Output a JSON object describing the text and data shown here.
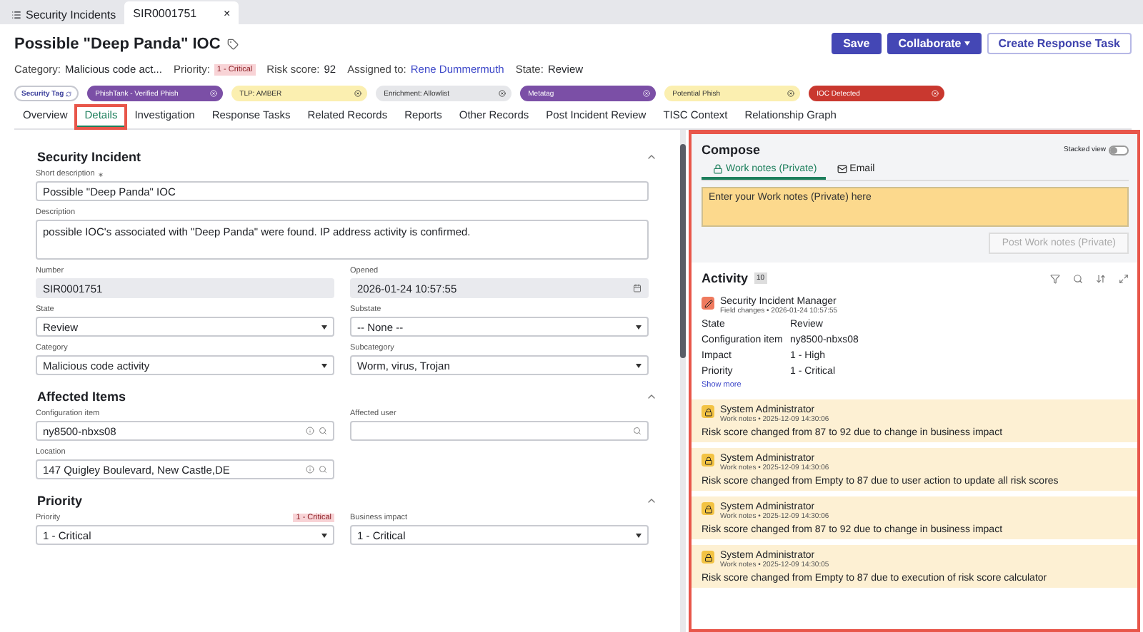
{
  "browser_tabs": [
    {
      "label": "Security Incidents",
      "selected": false,
      "kind": "list"
    },
    {
      "label": "SIR0001751",
      "selected": true,
      "kind": "record",
      "close": "×"
    }
  ],
  "header": {
    "title": "Possible \"Deep Panda\" IOC",
    "buttons": [
      {
        "label": "Save",
        "kind": "primary"
      },
      {
        "label": "Collaborate",
        "kind": "dropdown"
      },
      {
        "label": "Create Response Task",
        "kind": "outline"
      }
    ],
    "meta": [
      {
        "label": "Category:",
        "value": "Malicious code act...",
        "kind": "text"
      },
      {
        "label": "Priority:",
        "value": "1 - Critical",
        "kind": "badge"
      },
      {
        "label": "Risk score:",
        "value": "92",
        "kind": "text"
      },
      {
        "label": "Assigned to:",
        "value": "Rene Dummermuth",
        "kind": "link"
      },
      {
        "label": "State:",
        "value": "Review",
        "kind": "text"
      }
    ],
    "security_tag": "Security Tag",
    "tags": [
      {
        "label": "PhishTank - Verified Phish",
        "color": "#7b4fa6"
      },
      {
        "label": "TLP: AMBER",
        "color": "#fbefb0"
      },
      {
        "label": "Enrichment: Allowlist",
        "color": "#e6e7ea"
      },
      {
        "label": "Metatag",
        "color": "#7b4fa6"
      },
      {
        "label": "Potential Phish",
        "color": "#fbefb0"
      },
      {
        "label": "IOC Detected",
        "color": "#c9382f"
      }
    ]
  },
  "form_tabs": [
    {
      "label": "Overview",
      "selected": false
    },
    {
      "label": "Details",
      "selected": true
    },
    {
      "label": "Investigation",
      "selected": false
    },
    {
      "label": "Response Tasks",
      "selected": false
    },
    {
      "label": "Related Records",
      "selected": false
    },
    {
      "label": "Reports",
      "selected": false
    },
    {
      "label": "Other Records",
      "selected": false
    },
    {
      "label": "Post Incident Review",
      "selected": false
    },
    {
      "label": "TISC Context",
      "selected": false
    },
    {
      "label": "Relationship Graph",
      "selected": false
    }
  ],
  "sections": [
    {
      "title": "Security Incident",
      "fields": [
        {
          "label": "Short description",
          "required": true,
          "value": "Possible \"Deep Panda\" IOC",
          "kind": "text"
        },
        {
          "label": "Description",
          "value": "possible IOC's associated with \"Deep Panda\" were found. IP address activity is confirmed.",
          "kind": "textarea"
        },
        {
          "label": "Number",
          "value": "SIR0001751",
          "kind": "readonly"
        },
        {
          "label": "Opened",
          "value": "2026-01-24 10:57:55",
          "kind": "date"
        },
        {
          "label": "State",
          "value": "Review",
          "kind": "select"
        },
        {
          "label": "Substate",
          "value": "-- None --",
          "kind": "select"
        },
        {
          "label": "Category",
          "value": "Malicious code activity",
          "kind": "select"
        },
        {
          "label": "Subcategory",
          "value": "Worm, virus, Trojan",
          "kind": "select"
        }
      ]
    },
    {
      "title": "Affected Items",
      "fields": [
        {
          "label": "Configuration item",
          "value": "ny8500-nbxs08",
          "kind": "reference"
        },
        {
          "label": "Affected user",
          "kind": "lookup"
        },
        {
          "label": "Location",
          "value": "147 Quigley Boulevard, New Castle,DE",
          "kind": "reference"
        }
      ]
    },
    {
      "title": "Priority",
      "fields": [
        {
          "label": "Priority",
          "badge": "1 - Critical",
          "value": "1 - Critical",
          "kind": "select"
        },
        {
          "label": "Business impact",
          "value": "1 - Critical",
          "kind": "select"
        }
      ]
    }
  ],
  "compose": {
    "title": "Compose",
    "stacked_view": {
      "label": "Stacked view",
      "on": false
    },
    "tabs": [
      {
        "label": "Work notes (Private)",
        "selected": true,
        "kind": "lock"
      },
      {
        "label": "Email",
        "selected": false,
        "kind": "mail"
      }
    ],
    "placeholder": "Enter your Work notes (Private) here",
    "post_button": {
      "label": "Post Work notes (Private)",
      "disabled": true
    }
  },
  "activity": {
    "title": "Activity",
    "count": "10",
    "entries": [
      {
        "kind": "field_changes",
        "author": "Security Incident Manager",
        "meta": "Field changes • 2026-01-24 10:57:55",
        "changes": [
          {
            "field": "State",
            "value": "Review"
          },
          {
            "field": "Configuration item",
            "value": "ny8500-nbxs08"
          },
          {
            "field": "Impact",
            "value": "1 - High"
          },
          {
            "field": "Priority",
            "value": "1 - Critical"
          }
        ],
        "show_more": "Show more"
      },
      {
        "kind": "work_note",
        "author": "System Administrator",
        "meta": "Work notes • 2025-12-09 14:30:06",
        "text": "Risk score changed from 87 to 92 due to change in business impact"
      },
      {
        "kind": "work_note",
        "author": "System Administrator",
        "meta": "Work notes • 2025-12-09 14:30:06",
        "text": "Risk score changed from Empty to 87 due to user action to update all risk scores"
      },
      {
        "kind": "work_note",
        "author": "System Administrator",
        "meta": "Work notes • 2025-12-09 14:30:06",
        "text": "Risk score changed from 87 to 92 due to change in business impact"
      },
      {
        "kind": "work_note",
        "author": "System Administrator",
        "meta": "Work notes • 2025-12-09 14:30:05",
        "text": "Risk score changed from Empty to 87 due to execution of risk score calculator"
      }
    ]
  }
}
